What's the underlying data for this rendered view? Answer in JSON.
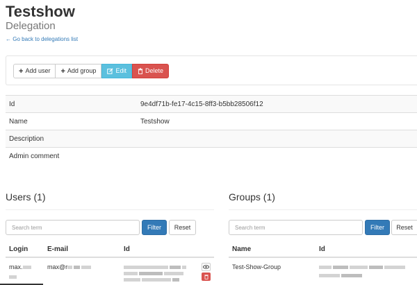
{
  "header": {
    "title": "Testshow",
    "subtitle": "Delegation",
    "back_link": "← Go back to delegations list"
  },
  "toolbar": {
    "add_user_label": "Add user",
    "add_group_label": "Add group",
    "edit_label": "Edit",
    "delete_label": "Delete"
  },
  "details": [
    {
      "key": "Id",
      "value": "9e4df71b-fe17-4c15-8ff3-b5bb28506f12"
    },
    {
      "key": "Name",
      "value": "Testshow"
    },
    {
      "key": "Description",
      "value": ""
    },
    {
      "key": "Admin comment",
      "value": ""
    }
  ],
  "users": {
    "title": "Users (1)",
    "search_placeholder": "Search term",
    "filter_label": "Filter",
    "reset_label": "Reset",
    "columns": [
      "Login",
      "E-mail",
      "Id"
    ],
    "rows": [
      {
        "login": "max.",
        "email": "max@r"
      }
    ]
  },
  "groups": {
    "title": "Groups (1)",
    "search_placeholder": "Search term",
    "filter_label": "Filter",
    "reset_label": "Reset",
    "columns": [
      "Name",
      "Id"
    ],
    "rows": [
      {
        "name": "Test-Show-Group"
      }
    ]
  },
  "colors": {
    "primary": "#337ab7",
    "info": "#5bc0de",
    "danger": "#d9534f"
  }
}
